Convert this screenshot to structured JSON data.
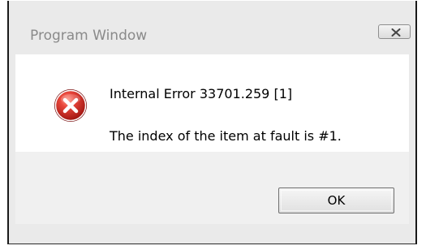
{
  "window": {
    "title": "Program Window"
  },
  "message": {
    "line1": "Internal Error 33701.259 [1]",
    "line2": "The index of the item at fault is #1."
  },
  "icons": {
    "error": "error-icon",
    "close": "close-icon"
  },
  "buttons": {
    "ok_label": "OK"
  },
  "colors": {
    "error_red": "#d32f2f",
    "title_text": "#8a8a8a",
    "dialog_bg": "#eaeaea",
    "content_bg": "#ffffff",
    "footer_bg": "#f0f0f0"
  }
}
